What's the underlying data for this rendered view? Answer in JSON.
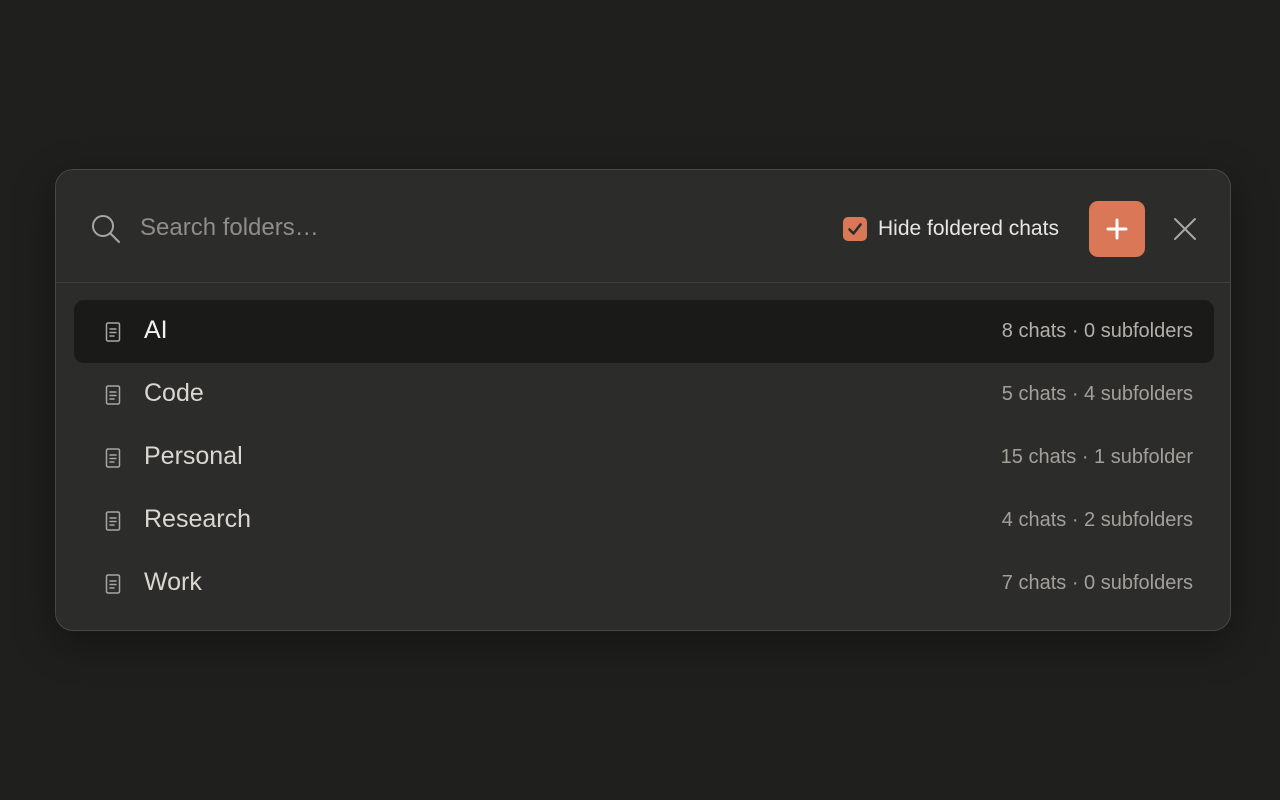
{
  "search": {
    "placeholder": "Search folders…",
    "icon": "search-icon"
  },
  "hide_foldered": {
    "label": "Hide foldered chats",
    "checked": true
  },
  "add_button": {
    "icon": "plus-icon"
  },
  "close_button": {
    "icon": "close-icon"
  },
  "colors": {
    "accent": "#d97757",
    "modal_bg": "#2c2c2b",
    "page_bg": "#1f1f1e",
    "selected_row_bg": "#1a1a19"
  },
  "folders": [
    {
      "name": "AI",
      "meta": "8 chats · 0 subfolders",
      "selected": true,
      "icon": "document-icon"
    },
    {
      "name": "Code",
      "meta": "5 chats · 4 subfolders",
      "selected": false,
      "icon": "document-icon"
    },
    {
      "name": "Personal",
      "meta": "15 chats · 1 subfolder",
      "selected": false,
      "icon": "document-icon"
    },
    {
      "name": "Research",
      "meta": "4 chats · 2 subfolders",
      "selected": false,
      "icon": "document-icon"
    },
    {
      "name": "Work",
      "meta": "7 chats · 0 subfolders",
      "selected": false,
      "icon": "document-icon"
    }
  ]
}
